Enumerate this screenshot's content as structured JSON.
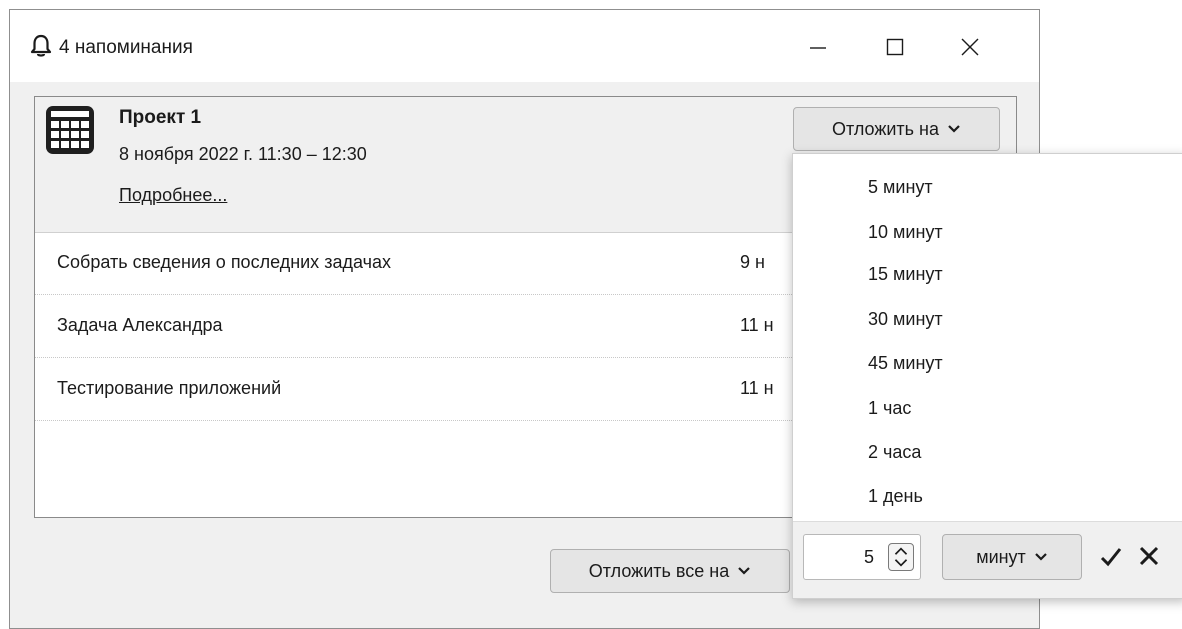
{
  "window": {
    "title": "4 напоминания",
    "controls": [
      "minimize-icon",
      "maximize-icon",
      "close-icon"
    ]
  },
  "event": {
    "title": "Проект 1",
    "date": "8 ноября 2022 г. 11:30 – 12:30",
    "details_link": "Подробнее...",
    "snooze_label": "Отложить на",
    "icon": "calendar-icon"
  },
  "reminders": [
    {
      "name": "Собрать сведения о последних задачах",
      "date": "9 н"
    },
    {
      "name": "Задача Александра",
      "date": "11 н"
    },
    {
      "name": "Тестирование приложений",
      "date": "11 н"
    }
  ],
  "snooze_all_label": "Отложить все на",
  "snooze_menu": {
    "items": [
      "5 минут",
      "10 минут",
      "15 минут",
      "30 минут",
      "45 минут",
      "1 час",
      "2 часа",
      "1 день"
    ],
    "custom_value": "5",
    "unit_label": "минут",
    "confirm_icon": "checkmark-icon",
    "cancel_icon": "close-icon"
  },
  "colors": {
    "window_bg": "#f0f0f0",
    "panel_bg": "#ffffff",
    "button_bg": "#e5e5e5",
    "text": "#1b1b1b"
  }
}
